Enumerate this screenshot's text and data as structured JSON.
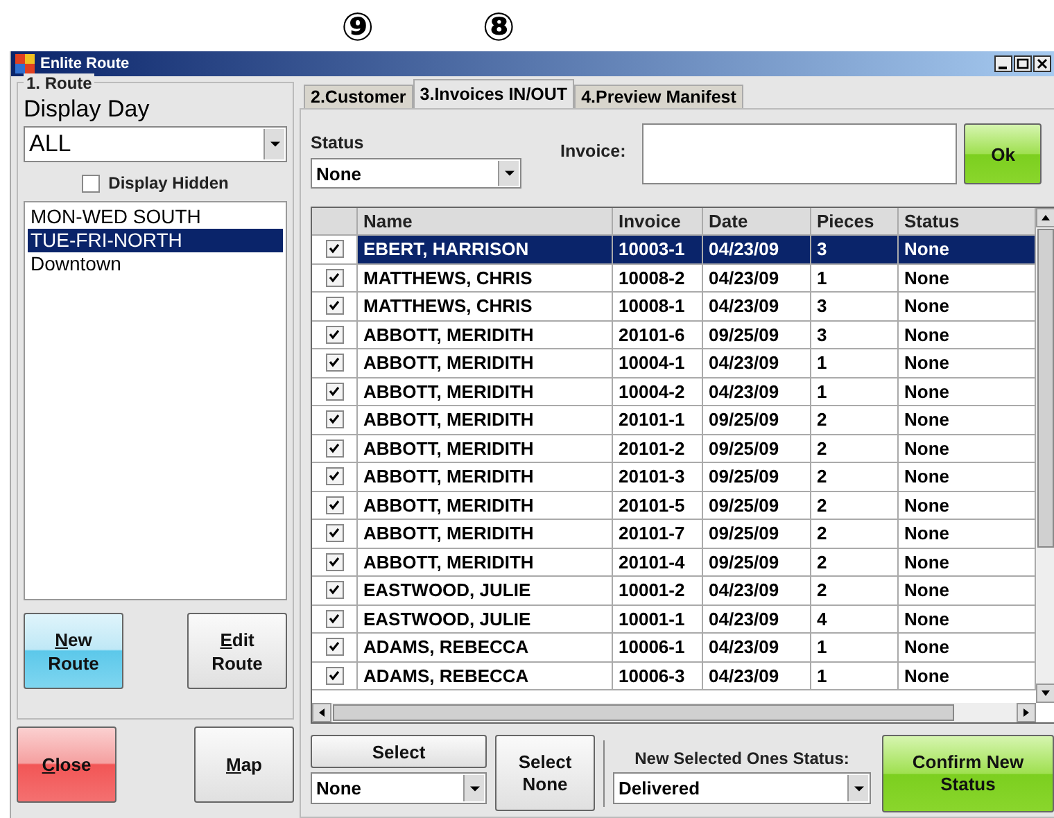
{
  "annotations": [
    "⑨",
    "⑧"
  ],
  "window": {
    "title": "Enlite Route"
  },
  "route_panel": {
    "title": "1. Route",
    "display_day_label": "Display Day",
    "display_day": "ALL",
    "display_hidden": {
      "label": "Display Hidden",
      "checked": false
    },
    "routes": [
      {
        "label": "MON-WED SOUTH",
        "selected": false
      },
      {
        "label": "TUE-FRI-NORTH",
        "selected": true
      },
      {
        "label": "Downtown",
        "selected": false
      }
    ],
    "buttons": [
      {
        "kind": "new",
        "key": "N",
        "rest": "ew",
        "line2": "Route"
      },
      {
        "kind": "edit",
        "key": "E",
        "rest": "dit",
        "line2": "Route"
      },
      {
        "kind": "close",
        "key": "C",
        "rest": "lose"
      },
      {
        "kind": "plain",
        "key": "M",
        "rest": "ap"
      }
    ]
  },
  "tabs": [
    {
      "label": "2.Customer",
      "selected": false
    },
    {
      "label": "3.Invoices IN/OUT",
      "selected": true
    },
    {
      "label": "4.Preview Manifest",
      "selected": false
    }
  ],
  "status_filter": {
    "label": "Status",
    "value": "None"
  },
  "invoice_field": {
    "label": "Invoice:"
  },
  "ok_button": "Ok",
  "table": {
    "columns": [
      "Name",
      "Invoice",
      "Date",
      "Pieces",
      "Status"
    ],
    "rows": [
      {
        "checked": true,
        "selected": true,
        "cells": [
          "EBERT, HARRISON",
          "10003-1",
          "04/23/09",
          "3",
          "None"
        ]
      },
      {
        "checked": true,
        "selected": false,
        "cells": [
          "MATTHEWS, CHRIS",
          "10008-2",
          "04/23/09",
          "1",
          "None"
        ]
      },
      {
        "checked": true,
        "selected": false,
        "cells": [
          "MATTHEWS, CHRIS",
          "10008-1",
          "04/23/09",
          "3",
          "None"
        ]
      },
      {
        "checked": true,
        "selected": false,
        "cells": [
          "ABBOTT, MERIDITH",
          "20101-6",
          "09/25/09",
          "3",
          "None"
        ]
      },
      {
        "checked": true,
        "selected": false,
        "cells": [
          "ABBOTT, MERIDITH",
          "10004-1",
          "04/23/09",
          "1",
          "None"
        ]
      },
      {
        "checked": true,
        "selected": false,
        "cells": [
          "ABBOTT, MERIDITH",
          "10004-2",
          "04/23/09",
          "1",
          "None"
        ]
      },
      {
        "checked": true,
        "selected": false,
        "cells": [
          "ABBOTT, MERIDITH",
          "20101-1",
          "09/25/09",
          "2",
          "None"
        ]
      },
      {
        "checked": true,
        "selected": false,
        "cells": [
          "ABBOTT, MERIDITH",
          "20101-2",
          "09/25/09",
          "2",
          "None"
        ]
      },
      {
        "checked": true,
        "selected": false,
        "cells": [
          "ABBOTT, MERIDITH",
          "20101-3",
          "09/25/09",
          "2",
          "None"
        ]
      },
      {
        "checked": true,
        "selected": false,
        "cells": [
          "ABBOTT, MERIDITH",
          "20101-5",
          "09/25/09",
          "2",
          "None"
        ]
      },
      {
        "checked": true,
        "selected": false,
        "cells": [
          "ABBOTT, MERIDITH",
          "20101-7",
          "09/25/09",
          "2",
          "None"
        ]
      },
      {
        "checked": true,
        "selected": false,
        "cells": [
          "ABBOTT, MERIDITH",
          "20101-4",
          "09/25/09",
          "2",
          "None"
        ]
      },
      {
        "checked": true,
        "selected": false,
        "cells": [
          "EASTWOOD, JULIE",
          "10001-2",
          "04/23/09",
          "2",
          "None"
        ]
      },
      {
        "checked": true,
        "selected": false,
        "cells": [
          "EASTWOOD, JULIE",
          "10001-1",
          "04/23/09",
          "4",
          "None"
        ]
      },
      {
        "checked": true,
        "selected": false,
        "cells": [
          "ADAMS, REBECCA",
          "10006-1",
          "04/23/09",
          "1",
          "None"
        ]
      },
      {
        "checked": true,
        "selected": false,
        "cells": [
          "ADAMS, REBECCA",
          "10006-3",
          "04/23/09",
          "1",
          "None"
        ]
      }
    ]
  },
  "select_button": "Select",
  "select_value": "None",
  "select_none_button": "Select None",
  "new_status": {
    "label": "New Selected Ones Status:",
    "value": "Delivered"
  },
  "confirm_button": "Confirm New Status"
}
